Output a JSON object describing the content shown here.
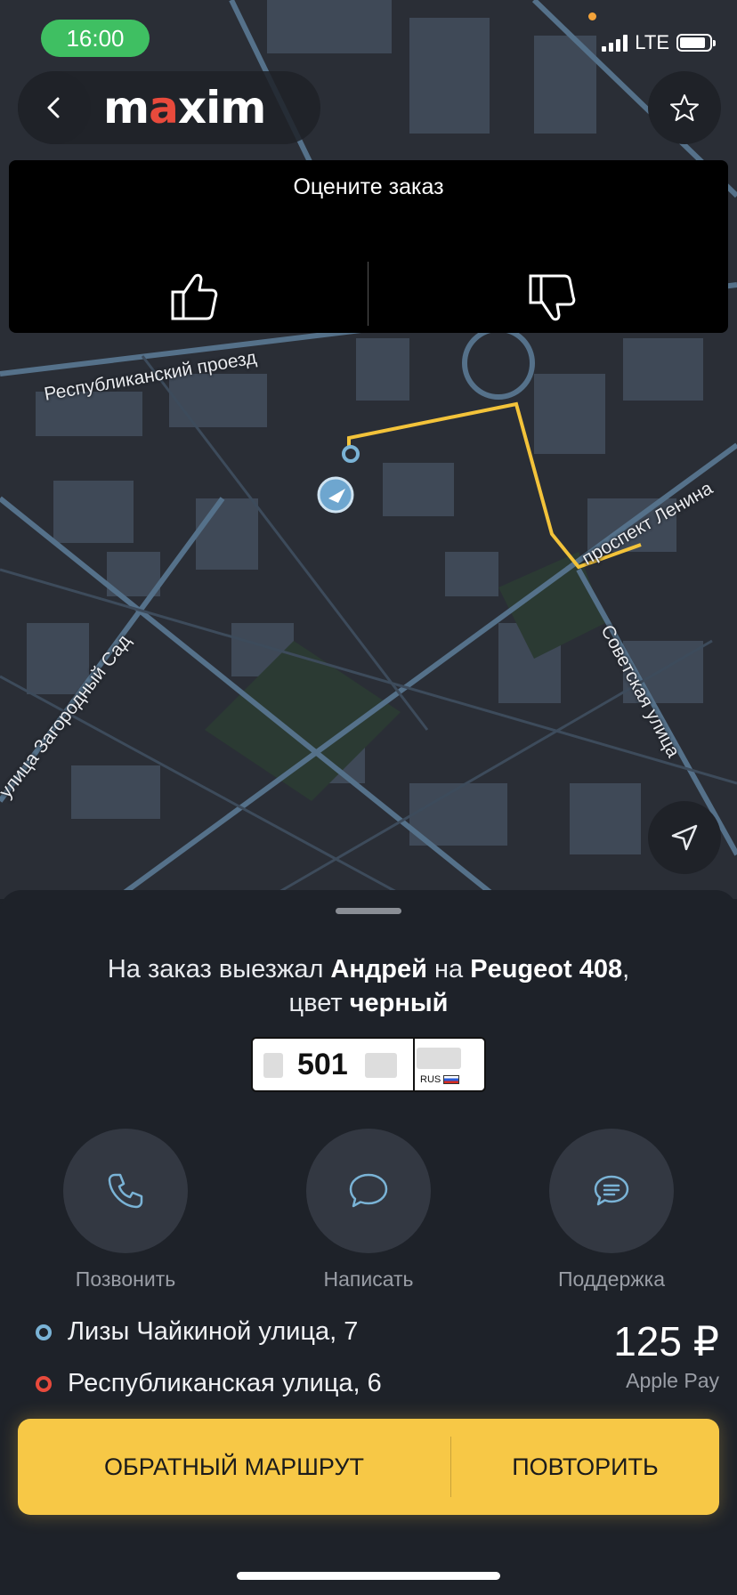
{
  "status_bar": {
    "time": "16:00",
    "network": "LTE"
  },
  "header": {
    "logo_prefix": "m",
    "logo_accent": "a",
    "logo_suffix": "xim",
    "back_icon": "chevron-left-icon",
    "favorite_icon": "star-icon"
  },
  "rating": {
    "title": "Оцените заказ",
    "like_icon": "thumbs-up-icon",
    "dislike_icon": "thumbs-down-icon"
  },
  "map": {
    "streets": [
      "Республиканский проезд",
      "проспект Ленина",
      "Советская улица",
      "улица Загородный Сад"
    ],
    "location_icon": "navigation-arrow-icon"
  },
  "driver": {
    "text_prefix": "На заказ выезжал ",
    "name": "Андрей",
    "text_on": " на ",
    "car": "Peugeot 408",
    "text_comma": ",",
    "text_color": "цвет ",
    "color": "черный"
  },
  "plate": {
    "number": "501",
    "country": "RUS"
  },
  "actions": [
    {
      "label": "Позвонить",
      "icon": "phone-icon"
    },
    {
      "label": "Написать",
      "icon": "chat-bubble-icon"
    },
    {
      "label": "Поддержка",
      "icon": "support-chat-icon"
    }
  ],
  "route": {
    "from": "Лизы Чайкиной улица, 7",
    "to": "Республиканская улица, 6"
  },
  "price": {
    "amount": "125 ₽",
    "payment": "Apple Pay"
  },
  "buttons": {
    "return_route": "ОБРАТНЫЙ МАРШРУТ",
    "repeat": "ПОВТОРИТЬ"
  },
  "colors": {
    "accent": "#f7c846",
    "route_line": "#f3c33a",
    "brand_red": "#e84a3c",
    "map_bg": "#2a2e36"
  }
}
